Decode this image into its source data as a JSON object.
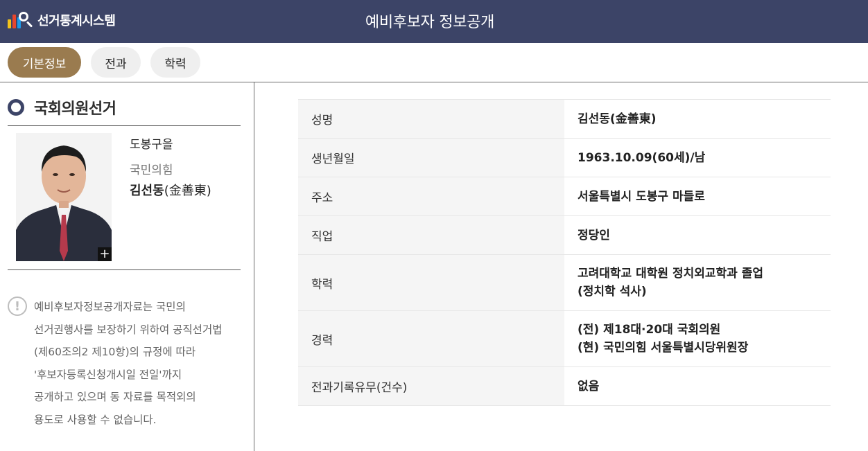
{
  "app": {
    "logo_text": "선거통계시스템",
    "page_title": "예비후보자 정보공개"
  },
  "tabs": [
    {
      "label": "기본정보",
      "active": true
    },
    {
      "label": "전과",
      "active": false
    },
    {
      "label": "학력",
      "active": false
    }
  ],
  "election": {
    "title": "국회의원선거"
  },
  "candidate": {
    "district": "도봉구을",
    "party": "국민의힘",
    "name": "김선동",
    "name_hanja": "(金善東)",
    "photo_zoom": "+"
  },
  "notice": {
    "lines": [
      "예비후보자정보공개자료는 국민의",
      "선거권행사를 보장하기 위하여 공직선거법",
      "(제60조의2 제10항)의 규정에 따라",
      "'후보자등록신청개시일 전일'까지",
      "공개하고 있으며 동 자료를 목적외의",
      "용도로 사용할 수 없습니다."
    ]
  },
  "info_rows": [
    {
      "label": "성명",
      "values": [
        "김선동(金善東)"
      ]
    },
    {
      "label": "생년월일",
      "values": [
        "1963.10.09(60세)/남"
      ]
    },
    {
      "label": "주소",
      "values": [
        "서울특별시 도봉구 마들로"
      ]
    },
    {
      "label": "직업",
      "values": [
        "정당인"
      ]
    },
    {
      "label": "학력",
      "values": [
        "고려대학교 대학원 정치외교학과 졸업",
        "(정치학 석사)"
      ]
    },
    {
      "label": "경력",
      "values": [
        "(전) 제18대·20대 국회의원",
        "(현) 국민의힘 서울특별시당위원장"
      ]
    },
    {
      "label": "전과기록유무(건수)",
      "values": [
        "없음"
      ]
    }
  ],
  "colors": {
    "header_bg": "#3c4467",
    "active_tab": "#9a7b4f",
    "row_label_bg": "#f5f5f5"
  }
}
